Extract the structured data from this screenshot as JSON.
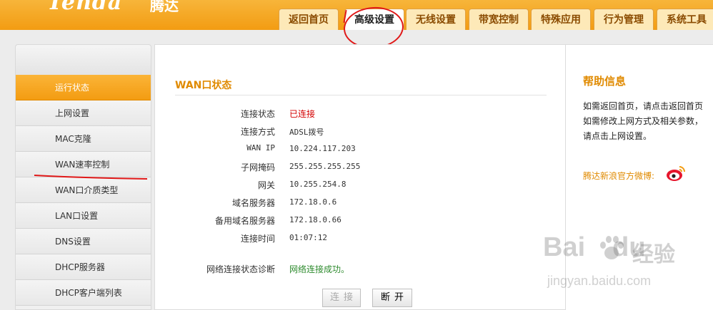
{
  "brand": {
    "logo_text": "Tenda",
    "logo_cn": "腾达"
  },
  "top_tabs": [
    {
      "label": "返回首页"
    },
    {
      "label": "高级设置"
    },
    {
      "label": "无线设置"
    },
    {
      "label": "带宽控制"
    },
    {
      "label": "特殊应用"
    },
    {
      "label": "行为管理"
    },
    {
      "label": "系统工具"
    }
  ],
  "sidebar": {
    "items": [
      {
        "label": "运行状态"
      },
      {
        "label": "上网设置"
      },
      {
        "label": "MAC克隆"
      },
      {
        "label": "WAN速率控制"
      },
      {
        "label": "WAN口介质类型"
      },
      {
        "label": "LAN口设置"
      },
      {
        "label": "DNS设置"
      },
      {
        "label": "DHCP服务器"
      },
      {
        "label": "DHCP客户端列表"
      }
    ]
  },
  "main": {
    "section_title": "WAN口状态",
    "rows": [
      {
        "label": "连接状态",
        "value": "已连接"
      },
      {
        "label": "连接方式",
        "value": "ADSL拨号"
      },
      {
        "label": "WAN IP",
        "value": "10.224.117.203"
      },
      {
        "label": "子网掩码",
        "value": "255.255.255.255"
      },
      {
        "label": "网关",
        "value": "10.255.254.8"
      },
      {
        "label": "域名服务器",
        "value": "172.18.0.6"
      },
      {
        "label": "备用域名服务器",
        "value": "172.18.0.66"
      },
      {
        "label": "连接时间",
        "value": "01:07:12"
      }
    ],
    "diagnosis": {
      "label": "网络连接状态诊断",
      "value": "网络连接成功。"
    },
    "buttons": {
      "connect": "连接",
      "disconnect": "断开"
    }
  },
  "help": {
    "title": "帮助信息",
    "text": "如需返回首页，请点击返回首页\n如需修改上网方式及相关参数，请点击上网设置。",
    "weibo_label": "腾达新浪官方微博:",
    "weibo_icon": "weibo-icon"
  },
  "watermark": {
    "logo": "Bai",
    "logo2": "du",
    "cn": "经验",
    "url": "jingyan.baidu.com"
  },
  "colors": {
    "accent": "#f39c12",
    "title": "#e08a00",
    "status_connected": "#d40000",
    "status_ok": "#2e8b2e"
  }
}
